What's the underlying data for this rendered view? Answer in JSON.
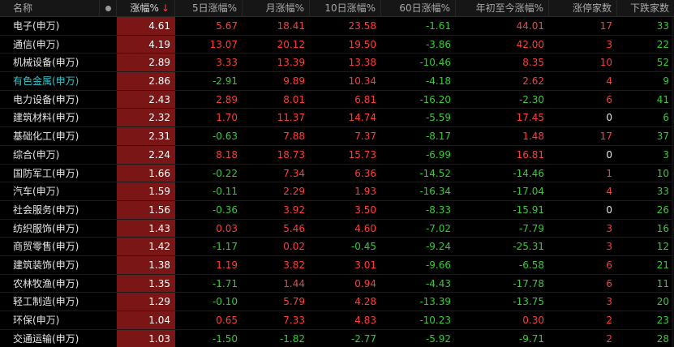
{
  "header": {
    "name": "名称",
    "change": "涨幅%",
    "sort_arrow": "↓",
    "d5": "5日涨幅%",
    "month": "月涨幅%",
    "d10": "10日涨幅%",
    "d60": "60日涨幅%",
    "ytd": "年初至今涨幅%",
    "limit_up": "涨停家数",
    "decliners": "下跌家数"
  },
  "rows": [
    {
      "name": "电子(申万)",
      "change": "4.61",
      "d5": "5.67",
      "month": "18.41",
      "d10": "23.58",
      "d60": "-1.61",
      "ytd": "44.01",
      "limit_up": "17",
      "decliners": "33"
    },
    {
      "name": "通信(申万)",
      "change": "4.19",
      "d5": "13.07",
      "month": "20.12",
      "d10": "19.50",
      "d60": "-3.86",
      "ytd": "42.00",
      "limit_up": "3",
      "decliners": "22"
    },
    {
      "name": "机械设备(申万)",
      "change": "2.89",
      "d5": "3.33",
      "month": "13.39",
      "d10": "13.38",
      "d60": "-10.46",
      "ytd": "8.35",
      "limit_up": "10",
      "decliners": "52"
    },
    {
      "name": "有色金属(申万)",
      "change": "2.86",
      "d5": "-2.91",
      "month": "9.89",
      "d10": "10.34",
      "d60": "-4.18",
      "ytd": "2.62",
      "limit_up": "4",
      "decliners": "9"
    },
    {
      "name": "电力设备(申万)",
      "change": "2.43",
      "d5": "2.89",
      "month": "8.01",
      "d10": "6.81",
      "d60": "-16.20",
      "ytd": "-2.30",
      "limit_up": "6",
      "decliners": "41"
    },
    {
      "name": "建筑材料(申万)",
      "change": "2.32",
      "d5": "1.70",
      "month": "11.37",
      "d10": "14.74",
      "d60": "-5.59",
      "ytd": "17.45",
      "limit_up": "0",
      "decliners": "6"
    },
    {
      "name": "基础化工(申万)",
      "change": "2.31",
      "d5": "-0.63",
      "month": "7.88",
      "d10": "7.37",
      "d60": "-8.17",
      "ytd": "1.48",
      "limit_up": "17",
      "decliners": "37"
    },
    {
      "name": "综合(申万)",
      "change": "2.24",
      "d5": "8.18",
      "month": "18.73",
      "d10": "15.73",
      "d60": "-6.99",
      "ytd": "16.81",
      "limit_up": "0",
      "decliners": "3"
    },
    {
      "name": "国防军工(申万)",
      "change": "1.66",
      "d5": "-0.22",
      "month": "7.34",
      "d10": "6.36",
      "d60": "-14.52",
      "ytd": "-14.46",
      "limit_up": "1",
      "decliners": "10"
    },
    {
      "name": "汽车(申万)",
      "change": "1.59",
      "d5": "-0.11",
      "month": "2.29",
      "d10": "1.93",
      "d60": "-16.34",
      "ytd": "-17.04",
      "limit_up": "4",
      "decliners": "33"
    },
    {
      "name": "社会服务(申万)",
      "change": "1.56",
      "d5": "-0.36",
      "month": "3.92",
      "d10": "3.50",
      "d60": "-8.33",
      "ytd": "-15.91",
      "limit_up": "0",
      "decliners": "26"
    },
    {
      "name": "纺织服饰(申万)",
      "change": "1.43",
      "d5": "0.03",
      "month": "5.46",
      "d10": "4.60",
      "d60": "-7.02",
      "ytd": "-7.79",
      "limit_up": "3",
      "decliners": "16"
    },
    {
      "name": "商贸零售(申万)",
      "change": "1.42",
      "d5": "-1.17",
      "month": "0.02",
      "d10": "-0.45",
      "d60": "-9.24",
      "ytd": "-25.31",
      "limit_up": "3",
      "decliners": "12"
    },
    {
      "name": "建筑装饰(申万)",
      "change": "1.38",
      "d5": "1.19",
      "month": "3.82",
      "d10": "3.01",
      "d60": "-9.66",
      "ytd": "-6.58",
      "limit_up": "6",
      "decliners": "21"
    },
    {
      "name": "农林牧渔(申万)",
      "change": "1.35",
      "d5": "-1.71",
      "month": "1.44",
      "d10": "0.94",
      "d60": "-4.43",
      "ytd": "-17.78",
      "limit_up": "6",
      "decliners": "11"
    },
    {
      "name": "轻工制造(申万)",
      "change": "1.29",
      "d5": "-0.10",
      "month": "5.79",
      "d10": "4.28",
      "d60": "-13.39",
      "ytd": "-13.75",
      "limit_up": "3",
      "decliners": "20"
    },
    {
      "name": "环保(申万)",
      "change": "1.04",
      "d5": "0.65",
      "month": "7.33",
      "d10": "4.83",
      "d60": "-10.23",
      "ytd": "0.30",
      "limit_up": "2",
      "decliners": "23"
    },
    {
      "name": "交通运输(申万)",
      "change": "1.03",
      "d5": "-1.50",
      "month": "-1.82",
      "d10": "-2.77",
      "d60": "-5.92",
      "ytd": "-9.71",
      "limit_up": "2",
      "decliners": "28"
    }
  ],
  "highlight_row": 3,
  "colors": {
    "up": "#ff3c3c",
    "down": "#33cc33",
    "change_cell_bg": "#7a1616",
    "highlight_name": "#35c3c8"
  }
}
